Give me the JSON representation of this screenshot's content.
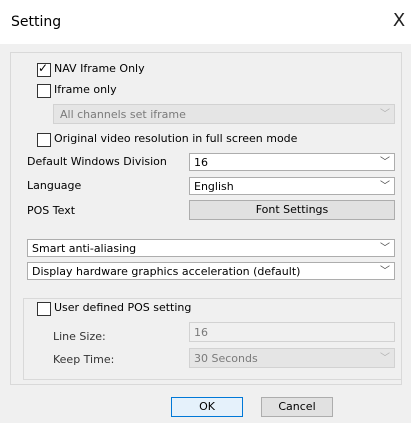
{
  "dialog": {
    "title": "Setting",
    "close_glyph": "X"
  },
  "options": {
    "nav_iframe_only": {
      "label": "NAV Iframe Only",
      "checked": true
    },
    "iframe_only": {
      "label": "Iframe only",
      "checked": false
    },
    "all_channels": {
      "value": "All channels set iframe"
    },
    "original_video_resolution": {
      "label": "Original video resolution in full screen mode",
      "checked": false
    },
    "default_windows_division": {
      "label": "Default Windows Division",
      "value": "16"
    },
    "language": {
      "label": "Language",
      "value": "English"
    },
    "pos_text": {
      "label": "POS Text",
      "button": "Font Settings"
    },
    "anti_aliasing": {
      "value": "Smart anti-aliasing"
    },
    "graphics_accel": {
      "value": "Display hardware graphics acceleration (default)"
    }
  },
  "user_pos": {
    "label": "User defined POS setting",
    "checked": false,
    "line_size": {
      "label": "Line Size:",
      "value": "16"
    },
    "keep_time": {
      "label": "Keep Time:",
      "value": "30 Seconds"
    }
  },
  "footer": {
    "ok": "OK",
    "cancel": "Cancel"
  },
  "icons": {
    "close": "close-icon",
    "dropdown": "chevron-down-icon",
    "checkmark": "check-icon"
  }
}
